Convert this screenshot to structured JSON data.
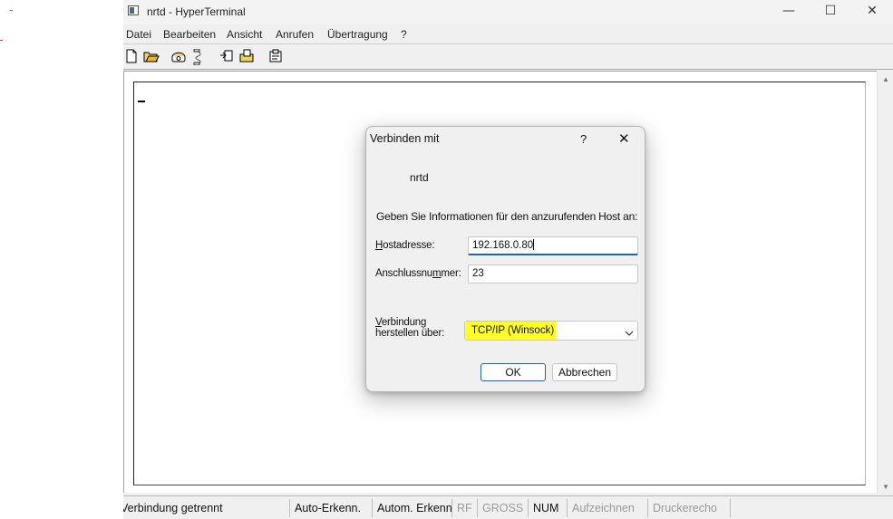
{
  "window": {
    "title": "nrtd - HyperTerminal",
    "controls": {
      "minimize": "—",
      "maximize": "☐",
      "close": "✕"
    }
  },
  "menu": [
    "Datei",
    "Bearbeiten",
    "Ansicht",
    "Anrufen",
    "Übertragung",
    "?"
  ],
  "toolbar": [
    "new-icon",
    "open-icon",
    "call-icon",
    "disconnect-icon",
    "send-icon",
    "receive-icon",
    "properties-icon"
  ],
  "dialog": {
    "title": "Verbinden mit",
    "help": "?",
    "close": "✕",
    "connection_name": "nrtd",
    "prompt": "Geben Sie Informationen für den anzurufenden Host an:",
    "host_label_prefix": "H",
    "host_label_rest": "ostadresse:",
    "host_value": "192.168.0.80",
    "port_label_a": "Anschlussnu",
    "port_label_u": "m",
    "port_label_b": "mer:",
    "port_value": "23",
    "via_label_line1_u": "V",
    "via_label_line1_rest": "erbindung",
    "via_label_line2": "herstellen über:",
    "via_value": "TCP/IP (Winsock)",
    "highlight_color": "#ffff22",
    "ok": "OK",
    "cancel": "Abbrechen"
  },
  "statusbar": {
    "connection": "Verbindung getrennt",
    "detect1": "Auto-Erkenn.",
    "detect2": "Autom. Erkenn.",
    "rf": "RF",
    "caps": "GROSS",
    "num": "NUM",
    "record": "Aufzeichnen",
    "echo": "Druckerecho"
  }
}
